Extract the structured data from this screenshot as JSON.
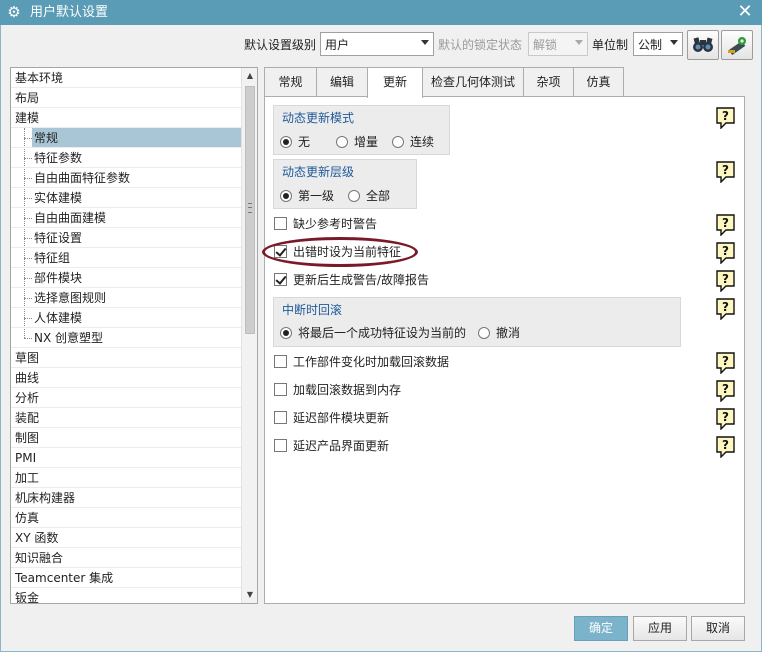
{
  "window": {
    "title": "用户默认设置"
  },
  "toolbar": {
    "level_label": "默认设置级别",
    "level_value": "用户",
    "lock_label": "默认的锁定状态",
    "lock_value": "解锁",
    "unit_label": "单位制",
    "unit_value": "公制"
  },
  "tree": {
    "items": [
      {
        "label": "基本环境",
        "level": 0
      },
      {
        "label": "布局",
        "level": 0
      },
      {
        "label": "建模",
        "level": 0
      },
      {
        "label": "常规",
        "level": 1,
        "selected": true
      },
      {
        "label": "特征参数",
        "level": 1
      },
      {
        "label": "自由曲面特征参数",
        "level": 1
      },
      {
        "label": "实体建模",
        "level": 1
      },
      {
        "label": "自由曲面建模",
        "level": 1
      },
      {
        "label": "特征设置",
        "level": 1
      },
      {
        "label": "特征组",
        "level": 1
      },
      {
        "label": "部件模块",
        "level": 1
      },
      {
        "label": "选择意图规则",
        "level": 1
      },
      {
        "label": "人体建模",
        "level": 1
      },
      {
        "label": "NX 创意塑型",
        "level": 1
      },
      {
        "label": "草图",
        "level": 0
      },
      {
        "label": "曲线",
        "level": 0
      },
      {
        "label": "分析",
        "level": 0
      },
      {
        "label": "装配",
        "level": 0
      },
      {
        "label": "制图",
        "level": 0
      },
      {
        "label": "PMI",
        "level": 0
      },
      {
        "label": "加工",
        "level": 0
      },
      {
        "label": "机床构建器",
        "level": 0
      },
      {
        "label": "仿真",
        "level": 0
      },
      {
        "label": "XY 函数",
        "level": 0
      },
      {
        "label": "知识融合",
        "level": 0
      },
      {
        "label": "Teamcenter 集成",
        "level": 0
      },
      {
        "label": "钣金",
        "level": 0
      }
    ]
  },
  "tabs": [
    {
      "label": "常规",
      "active": false
    },
    {
      "label": "编辑",
      "active": false
    },
    {
      "label": "更新",
      "active": true
    },
    {
      "label": "检查几何体测试",
      "active": false
    },
    {
      "label": "杂项",
      "active": false
    },
    {
      "label": "仿真",
      "active": false
    }
  ],
  "panel": {
    "dynamic_mode": {
      "title": "动态更新模式",
      "options": [
        "无",
        "增量",
        "连续"
      ],
      "selected": "无"
    },
    "dynamic_level": {
      "title": "动态更新层级",
      "options": [
        "第一级",
        "全部"
      ],
      "selected": "第一级"
    },
    "checks_top": [
      {
        "label": "缺少参考时警告",
        "checked": false
      },
      {
        "label": "出错时设为当前特征",
        "checked": true
      },
      {
        "label": "更新后生成警告/故障报告",
        "checked": true
      }
    ],
    "rollback": {
      "title": "中断时回滚",
      "options": [
        "将最后一个成功特征设为当前的",
        "撤消"
      ],
      "selected": "将最后一个成功特征设为当前的"
    },
    "checks_bottom": [
      {
        "label": "工作部件变化时加载回滚数据",
        "checked": false
      },
      {
        "label": "加载回滚数据到内存",
        "checked": false
      },
      {
        "label": "延迟部件模块更新",
        "checked": false
      },
      {
        "label": "延迟产品界面更新",
        "checked": false
      }
    ]
  },
  "buttons": {
    "ok": "确定",
    "apply": "应用",
    "cancel": "取消"
  }
}
